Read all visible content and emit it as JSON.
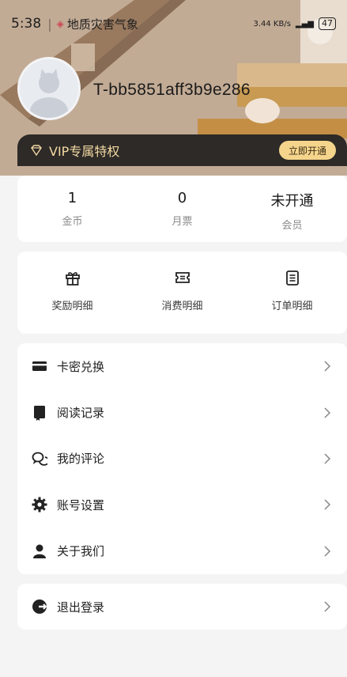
{
  "status_bar": {
    "time": "5:38",
    "notification": "地质灾害气象",
    "net_speed": "3.44 KB/s",
    "battery": "47"
  },
  "profile": {
    "username": "T-bb5851aff3b9e286"
  },
  "vip": {
    "label": "VIP专属特权",
    "button_label": "立即开通"
  },
  "stats": [
    {
      "value": "1",
      "label": "金币"
    },
    {
      "value": "0",
      "label": "月票"
    },
    {
      "value": "未开通",
      "label": "会员"
    }
  ],
  "records": [
    {
      "label": "奖励明细",
      "icon": "gift-icon"
    },
    {
      "label": "消费明细",
      "icon": "ticket-icon"
    },
    {
      "label": "订单明细",
      "icon": "clipboard-icon"
    }
  ],
  "menu": [
    {
      "label": "卡密兑换",
      "icon": "card-icon"
    },
    {
      "label": "阅读记录",
      "icon": "book-icon"
    },
    {
      "label": "我的评论",
      "icon": "chat-icon"
    },
    {
      "label": "账号设置",
      "icon": "gear-icon"
    },
    {
      "label": "关于我们",
      "icon": "user-icon"
    }
  ],
  "logout": {
    "label": "退出登录",
    "icon": "logout-icon"
  },
  "colors": {
    "vip_bar": "#2d2a27",
    "vip_text": "#f3d9a3",
    "vip_button": "#f5d48c",
    "page_bg": "#f4f4f5"
  }
}
